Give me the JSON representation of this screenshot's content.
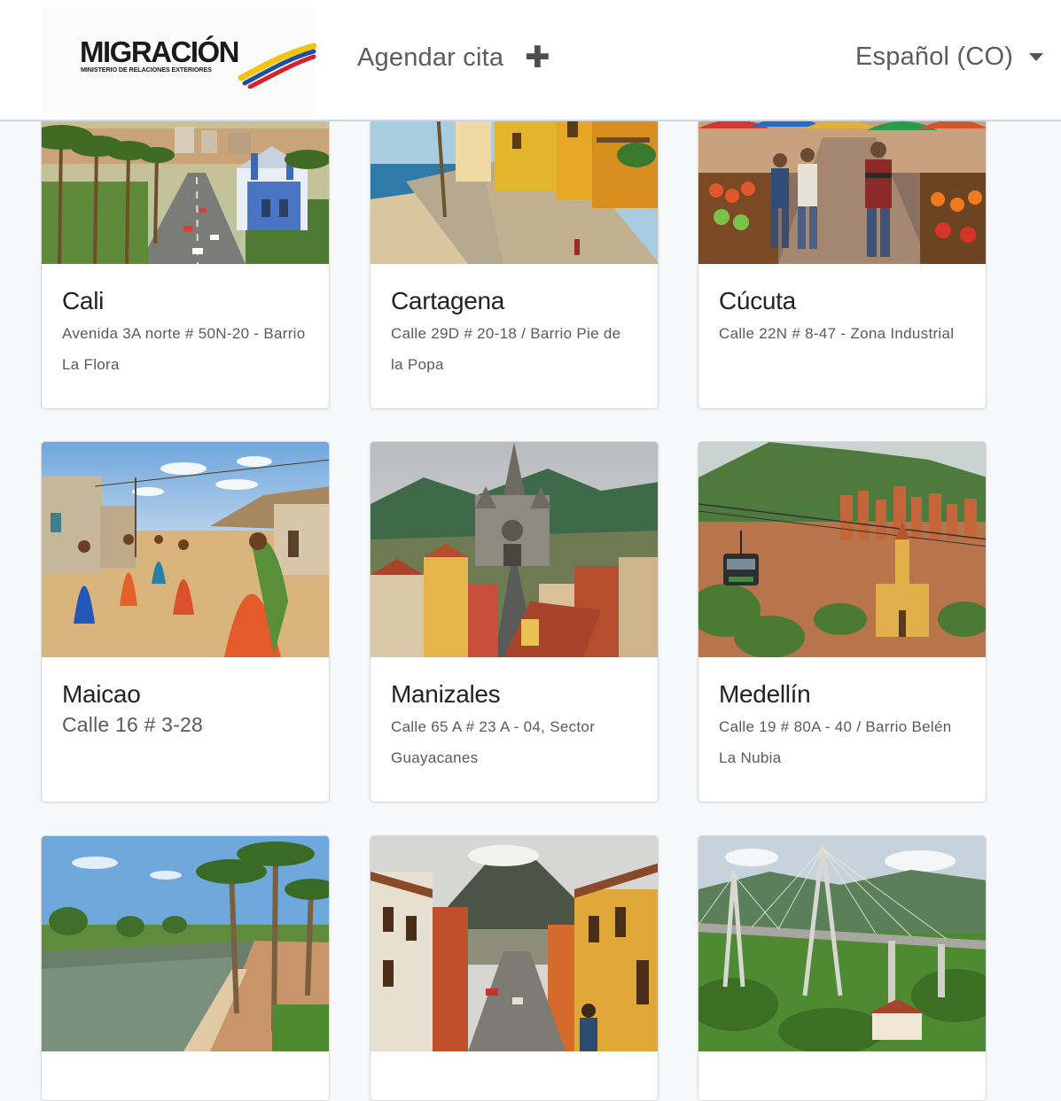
{
  "header": {
    "logo": {
      "name": "MIGRACIÓN",
      "subtitle": "MINISTERIO DE RELACIONES EXTERIORES",
      "flag_colors": [
        "#f2c40f",
        "#1e4fa3",
        "#d8222b"
      ]
    },
    "schedule_link": {
      "label": "Agendar cita",
      "icon": "plus-icon"
    },
    "language": {
      "selected": "Español (CO)",
      "icon": "caret-down-icon"
    }
  },
  "offices": [
    {
      "city": "Cali",
      "address": "Avenida 3A norte # 50N-20 - Barrio La Flora",
      "image": "palm-avenue-church"
    },
    {
      "city": "Cartagena",
      "address": "Calle 29D # 20-18 / Barrio Pie de la Popa",
      "image": "colonial-seafront"
    },
    {
      "city": "Cúcuta",
      "address": "Calle 22N # 8-47 - Zona Industrial",
      "image": "street-market"
    },
    {
      "city": "Maicao",
      "address": "Calle 16 # 3-28",
      "image": "dusty-street-women"
    },
    {
      "city": "Manizales",
      "address": "Calle 65 A # 23 A - 04, Sector Guayacanes",
      "image": "cathedral-hills"
    },
    {
      "city": "Medellín",
      "address": "Calle 19 # 80A - 40 / Barrio Belén La Nubia",
      "image": "city-cable-car"
    },
    {
      "city": "",
      "address": "",
      "image": "riverside-promenade"
    },
    {
      "city": "",
      "address": "",
      "image": "volcano-colonial-street"
    },
    {
      "city": "",
      "address": "",
      "image": "cable-bridge-valley"
    }
  ]
}
